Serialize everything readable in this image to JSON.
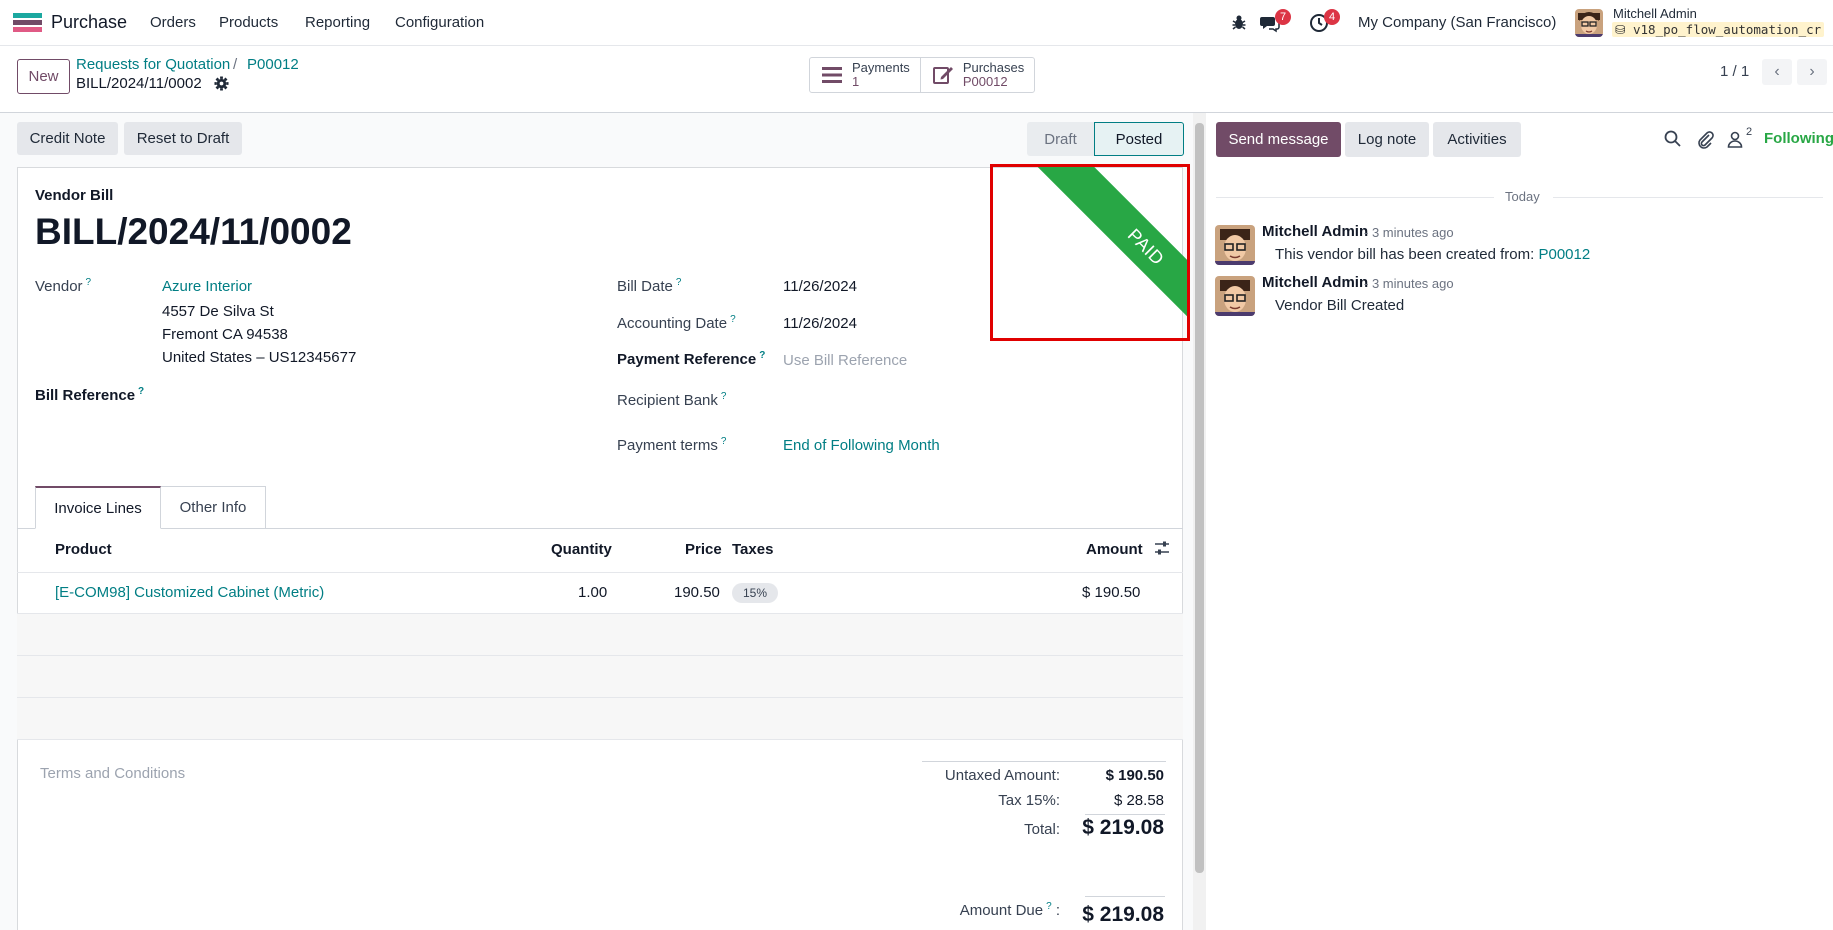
{
  "navbar": {
    "app_name": "Purchase",
    "menu": [
      "Orders",
      "Products",
      "Reporting",
      "Configuration"
    ],
    "messages_count": "7",
    "activities_count": "4",
    "company": "My Company (San Francisco)",
    "user_name": "Mitchell Admin",
    "db_name": "v18_po_flow_automation_cr"
  },
  "control": {
    "new_label": "New",
    "breadcrumb_parent": "Requests for Quotation",
    "breadcrumb_sep": "/",
    "breadcrumb_po": "P00012",
    "breadcrumb_current": "BILL/2024/11/0002",
    "smart_buttons": [
      {
        "label": "Payments",
        "value": "1",
        "icon": "list-icon"
      },
      {
        "label": "Purchases",
        "value": "P00012",
        "icon": "edit-icon"
      }
    ],
    "pager": "1 / 1"
  },
  "form": {
    "actions": [
      "Credit Note",
      "Reset to Draft"
    ],
    "statuses": [
      "Draft",
      "Posted"
    ],
    "ribbon": "PAID",
    "doc_type": "Vendor Bill",
    "doc_name": "BILL/2024/11/0002",
    "vendor_label": "Vendor",
    "vendor_name": "Azure Interior",
    "vendor_addr1": "4557 De Silva St",
    "vendor_addr2": "Fremont CA 94538",
    "vendor_addr3": "United States – US12345677",
    "bill_ref_label": "Bill Reference",
    "bill_date_label": "Bill Date",
    "bill_date": "11/26/2024",
    "acc_date_label": "Accounting Date",
    "acc_date": "11/26/2024",
    "pay_ref_label": "Payment Reference",
    "pay_ref_placeholder": "Use Bill Reference",
    "recipient_bank_label": "Recipient Bank",
    "pay_terms_label": "Payment terms",
    "pay_terms": "End of Following Month",
    "tabs": [
      "Invoice Lines",
      "Other Info"
    ],
    "columns": {
      "product": "Product",
      "quantity": "Quantity",
      "price": "Price",
      "taxes": "Taxes",
      "amount": "Amount"
    },
    "lines": [
      {
        "product": "[E-COM98] Customized Cabinet (Metric)",
        "quantity": "1.00",
        "price": "190.50",
        "tax": "15%",
        "amount": "$ 190.50"
      }
    ],
    "terms_placeholder": "Terms and Conditions",
    "untaxed_label": "Untaxed Amount:",
    "untaxed": "$ 190.50",
    "tax_label": "Tax 15%:",
    "tax": "$ 28.58",
    "total_label": "Total:",
    "total": "$ 219.08",
    "amount_due_label": "Amount Due",
    "amount_due_colon": ":",
    "amount_due": "$ 219.08"
  },
  "chatter": {
    "send_message": "Send message",
    "log_note": "Log note",
    "activities": "Activities",
    "followers_count": "2",
    "following": "Following",
    "today": "Today",
    "messages": [
      {
        "author": "Mitchell Admin",
        "time": "- 3 minutes ago",
        "body": "This vendor bill has been created from:",
        "link": "P00012"
      },
      {
        "author": "Mitchell Admin",
        "time": "- 3 minutes ago",
        "body": "Vendor Bill Created",
        "link": ""
      }
    ]
  },
  "colors": {
    "brand": "#714b67",
    "link": "#017e84",
    "paid": "#28a745"
  }
}
